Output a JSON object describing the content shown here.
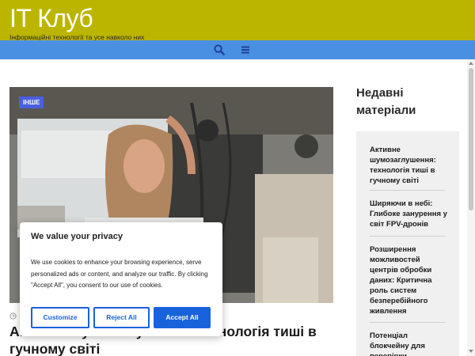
{
  "site": {
    "title": "IT Клуб",
    "tagline": "Інформаційні технології та усе навколо них"
  },
  "navigation": {
    "search_icon": "search-icon",
    "menu_icon": "hamburger-menu-icon"
  },
  "featured_post": {
    "category": "ІНШЕ",
    "title": "Активне шумозаглушення: технологія тиші в гучному світі"
  },
  "sidebar": {
    "title": "Недавні матеріали",
    "recent": [
      {
        "title": "Активне шумозаглушення: технологія тиші в гучному світі"
      },
      {
        "title": "Ширяючи в небі: Глибоке занурення у світ FPV-дронів"
      },
      {
        "title": "Розширення можливостей центрів обробки даних: Критична роль систем безперебійного живлення"
      },
      {
        "title": "Потенціал блокчейну для перевірки"
      }
    ]
  },
  "cookie_banner": {
    "title": "We value your privacy",
    "text": "We use cookies to enhance your browsing experience, serve personalized ads or content, and analyze our traffic. By clicking \"Accept All\", you consent to our use of cookies.",
    "customize_label": "Customize",
    "reject_label": "Reject All",
    "accept_label": "Accept All"
  },
  "colors": {
    "header": "#bcb500",
    "nav": "#4a90e2",
    "badge": "#4a5fe0",
    "cookie_primary": "#1863dc"
  }
}
